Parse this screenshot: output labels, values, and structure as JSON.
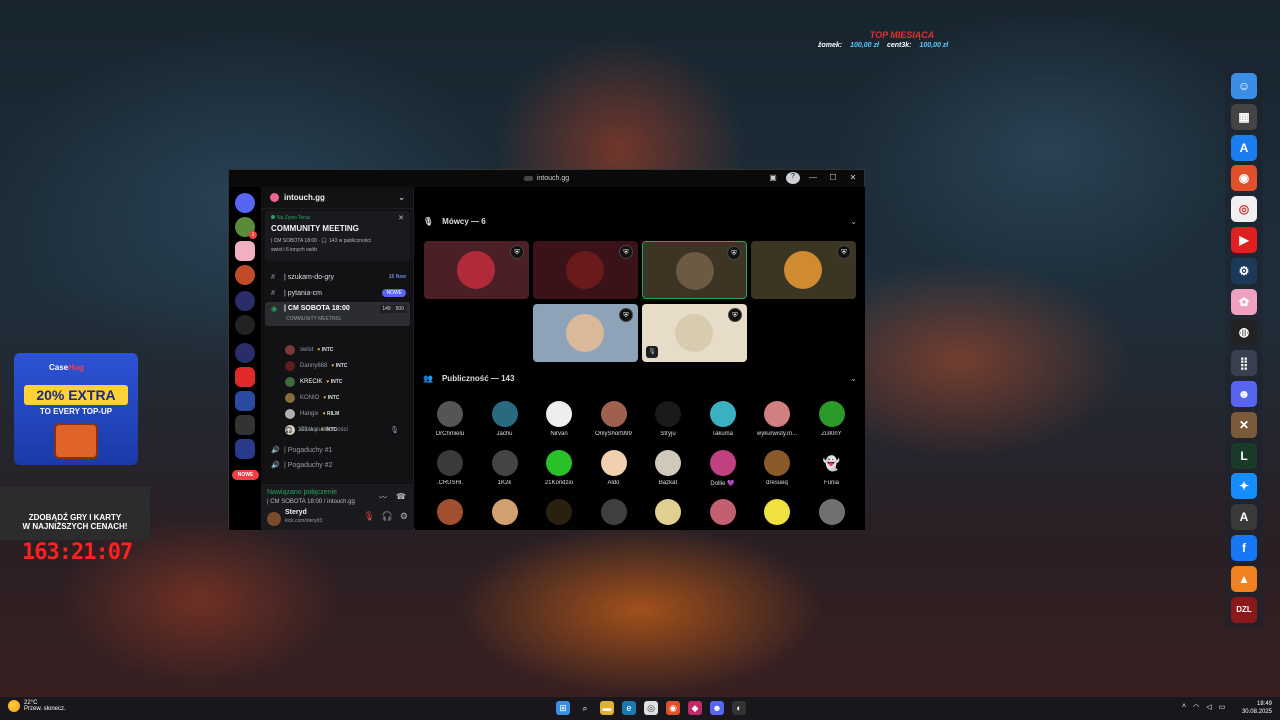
{
  "overlay": {
    "title": "TOP MIESIĄCA",
    "entries": [
      {
        "name": "žomek:",
        "amount": "100,00 zł"
      },
      {
        "name": "cent3k:",
        "amount": "100,00 zł"
      }
    ]
  },
  "ad": {
    "logo_a": "Case",
    "logo_b": "Hug",
    "extra": "20% EXTRA",
    "sub": "TO EVERY TOP-UP",
    "banner_line1": "ZDOBĄDŹ GRY I KARTY",
    "banner_line2": "W NAJNIŻSZYCH CENACH!",
    "countdown": "163:21:07"
  },
  "window": {
    "title": "intouch.gg",
    "controls": {
      "minimize": "—",
      "maximize": "☐",
      "close": "✕",
      "help": "?"
    }
  },
  "sidebar": {
    "server_name": "intouch.gg",
    "event": {
      "live_label": "Na Żywo Teraz",
      "title": "COMMUNITY MEETING",
      "info": "| CM SOBOTA 18:00 · 🎧 143 w publiczności",
      "info2": "swist i 6 innych osób"
    },
    "channels": [
      {
        "icon": "#",
        "name": "| szukam-do-gry",
        "badge": "15 New"
      },
      {
        "icon": "#",
        "name": "| pytania-cm",
        "badge": "NOWE"
      },
      {
        "icon": "◉",
        "name": "| CM SOBOTA 18:00",
        "sub": "COMMUNITY MEETING",
        "count_a": "149",
        "count_b": "500"
      }
    ],
    "voice_users": [
      {
        "name": "swist",
        "tag": "INTC",
        "color": "#7a3a3a"
      },
      {
        "name": "Danny888",
        "tag": "INTC",
        "color": "#5a1e1e"
      },
      {
        "name": "KRECIK",
        "tag": "INTC",
        "color": "#3b6b3b"
      },
      {
        "name": "KONIO",
        "tag": "INTC",
        "color": "#8a6a3a"
      },
      {
        "name": "Hangix",
        "tag": "RILM",
        "color": "#b0b0b0"
      },
      {
        "name": "Ciotka",
        "tag": "INTC",
        "color": "#d8d0c0"
      }
    ],
    "audience_note": "143 w publiczności",
    "other_channels": [
      "| Pogaduchy #1",
      "| Pogaduchy #2"
    ],
    "connection": {
      "status": "Nawiązano połączenie",
      "detail": "| CM SOBOTA 18:00 / intouch.gg"
    },
    "user": {
      "name": "Steryd",
      "status": "kick.com/steryd3"
    }
  },
  "stage": {
    "speakers_label": "Mówcy — 6",
    "audience_label": "Publiczność — 143",
    "speakers": [
      {
        "bg": "#4a1f26",
        "av": "#b02a3a"
      },
      {
        "bg": "#3a1218",
        "av": "#6a1a1a"
      },
      {
        "bg": "#3d3424",
        "av": "#6b5a44"
      },
      {
        "bg": "#3b3624",
        "av": "#d08a30"
      },
      {
        "bg": "#8fa3b8",
        "av": "#d9b99a"
      },
      {
        "bg": "#e6dcc8",
        "av": "#d8ccb0"
      }
    ],
    "audience": [
      {
        "name": "DrChmielu",
        "color": "#555"
      },
      {
        "name": "Jachu",
        "color": "#2a6a80"
      },
      {
        "name": "Nirvan",
        "color": "#eeeeee"
      },
      {
        "name": "OnlyShort999",
        "color": "#a06050"
      },
      {
        "name": "Stryju",
        "color": "#1a1a1a"
      },
      {
        "name": "Takuma",
        "color": "#3ab0c0"
      },
      {
        "name": "wykurwisty.m...",
        "color": "#d08080"
      },
      {
        "name": "Zi3l0nY",
        "color": "#2a9a2a"
      },
      {
        "name": ".CRUSHI.",
        "color": "#3a3a3a"
      },
      {
        "name": "1K2k",
        "color": "#444"
      },
      {
        "name": "21Kondzio",
        "color": "#2ac02a"
      },
      {
        "name": "Aldo",
        "color": "#f0d0b0"
      },
      {
        "name": "Bazkat",
        "color": "#d0c8b8"
      },
      {
        "name": "Dollie 💜",
        "color": "#c04080"
      },
      {
        "name": "dresueq",
        "color": "#8a5a2a"
      },
      {
        "name": "Funia",
        "color": "#000000"
      },
      {
        "name": "",
        "color": "#a05030"
      },
      {
        "name": "",
        "color": "#d0a070"
      },
      {
        "name": "",
        "color": "#2a2010"
      },
      {
        "name": "",
        "color": "#404040"
      },
      {
        "name": "",
        "color": "#e0d090"
      },
      {
        "name": "",
        "color": "#c06070"
      },
      {
        "name": "",
        "color": "#f0e040"
      },
      {
        "name": "",
        "color": "#707070"
      }
    ]
  },
  "dock": [
    {
      "name": "finder-icon",
      "color": "#3a8ee6",
      "glyph": "☺"
    },
    {
      "name": "calculator-icon",
      "color": "#444",
      "glyph": "▦"
    },
    {
      "name": "app-store-icon",
      "color": "#1a7ef0",
      "glyph": "A"
    },
    {
      "name": "firefox-icon",
      "color": "#e0502a",
      "glyph": "◉"
    },
    {
      "name": "chrome-icon",
      "color": "#f0f0f0",
      "glyph": "◎"
    },
    {
      "name": "youtube-icon",
      "color": "#e02020",
      "glyph": "▶"
    },
    {
      "name": "steam-icon",
      "color": "#1b3a5a",
      "glyph": "⚙"
    },
    {
      "name": "photos-icon",
      "color": "#f0a0c0",
      "glyph": "✿"
    },
    {
      "name": "obs-icon",
      "color": "#222",
      "glyph": "◍"
    },
    {
      "name": "launchpad-icon",
      "color": "#3a4050",
      "glyph": "⣿"
    },
    {
      "name": "discord-icon",
      "color": "#5865f2",
      "glyph": "☻"
    },
    {
      "name": "game-icon",
      "color": "#7a5a3a",
      "glyph": "✕"
    },
    {
      "name": "league-icon",
      "color": "#1a3a2a",
      "glyph": "L"
    },
    {
      "name": "battlenet-icon",
      "color": "#148eff",
      "glyph": "✦"
    },
    {
      "name": "arma-icon",
      "color": "#3a3a3a",
      "glyph": "A"
    },
    {
      "name": "facebook-icon",
      "color": "#1877f2",
      "glyph": "f"
    },
    {
      "name": "map-icon",
      "color": "#f08020",
      "glyph": "▲"
    },
    {
      "name": "dzl-icon",
      "color": "#8a1a1a",
      "glyph": "DZL"
    }
  ],
  "taskbar": {
    "temp": "22°C",
    "weather": "Przew. słonecz.",
    "time": "18:49",
    "date": "30.08.2025"
  },
  "colors": {
    "accent": "#5865f2",
    "online": "#23a55a",
    "danger": "#f23f43"
  }
}
